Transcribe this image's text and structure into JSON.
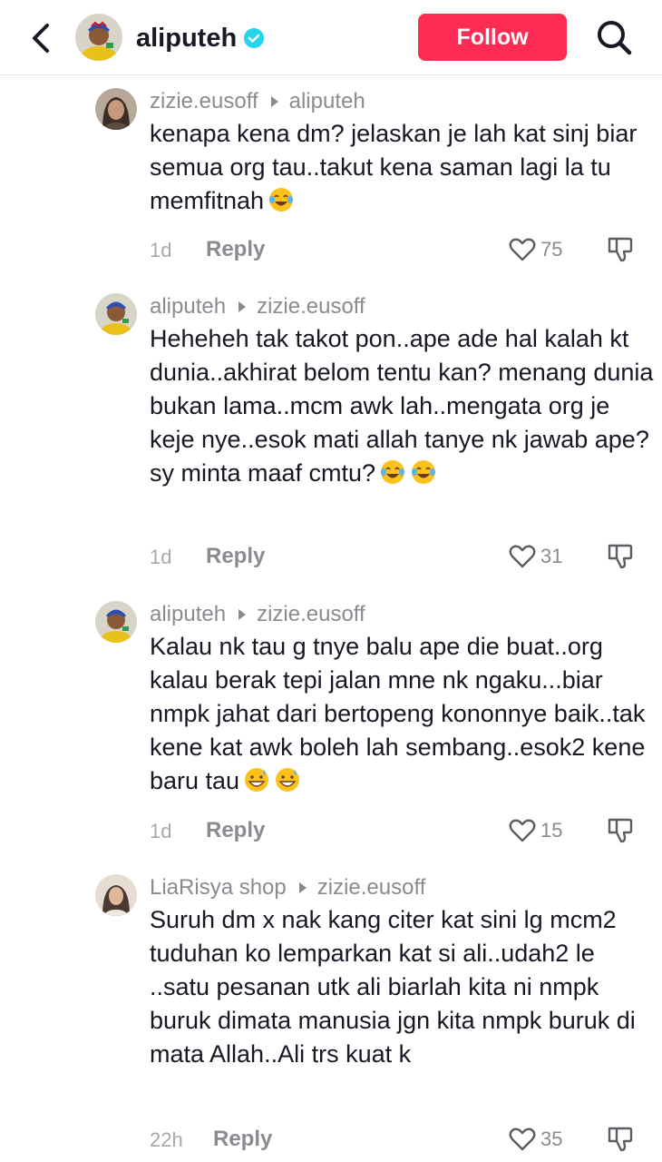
{
  "header": {
    "username": "aliputeh",
    "follow_label": "Follow"
  },
  "comments": [
    {
      "author": "zizie.eusoff",
      "reply_to": "aliputeh",
      "text": "kenapa kena dm? jelaskan je lah kat sinj biar semua org tau..takut kena saman lagi la tu memfitnah",
      "emojis": [
        "face-with-tears-of-joy"
      ],
      "time": "1d",
      "reply_label": "Reply",
      "likes": "75"
    },
    {
      "author": "aliputeh",
      "reply_to": "zizie.eusoff",
      "text": "Heheheh tak takot pon..ape ade hal kalah kt dunia..akhirat belom tentu kan? menang dunia bukan lama..mcm awk lah..mengata org je keje nye..esok mati allah tanye nk jawab ape?sy minta maaf cmtu?",
      "emojis": [
        "face-with-tears-of-joy",
        "face-with-tears-of-joy"
      ],
      "time": "1d",
      "reply_label": "Reply",
      "likes": "31"
    },
    {
      "author": "aliputeh",
      "reply_to": "zizie.eusoff",
      "text": "Kalau nk tau g tnye balu ape die buat..org kalau berak tepi jalan mne nk ngaku...biar nmpk jahat dari bertopeng kononnye baik..tak kene kat awk boleh lah sembang..esok2 kene baru tau",
      "emojis": [
        "grinning-face-with-sweat",
        "grinning-face-with-sweat"
      ],
      "time": "1d",
      "reply_label": "Reply",
      "likes": "15"
    },
    {
      "author": "LiaRisya shop",
      "reply_to": "zizie.eusoff",
      "text": "Suruh dm x nak kang citer kat sini lg mcm2 tuduhan ko lemparkan kat si ali..udah2 le ..satu pesanan utk ali biarlah kita ni nmpk buruk dimata manusia jgn kita nmpk buruk di mata Allah..Ali trs kuat k",
      "emojis": [],
      "time": "22h",
      "reply_label": "Reply",
      "likes": "35"
    }
  ],
  "colors": {
    "follow_button": "#fe2c55",
    "verified_badge": "#20d5ec",
    "secondary_text": "#8a8b91"
  }
}
